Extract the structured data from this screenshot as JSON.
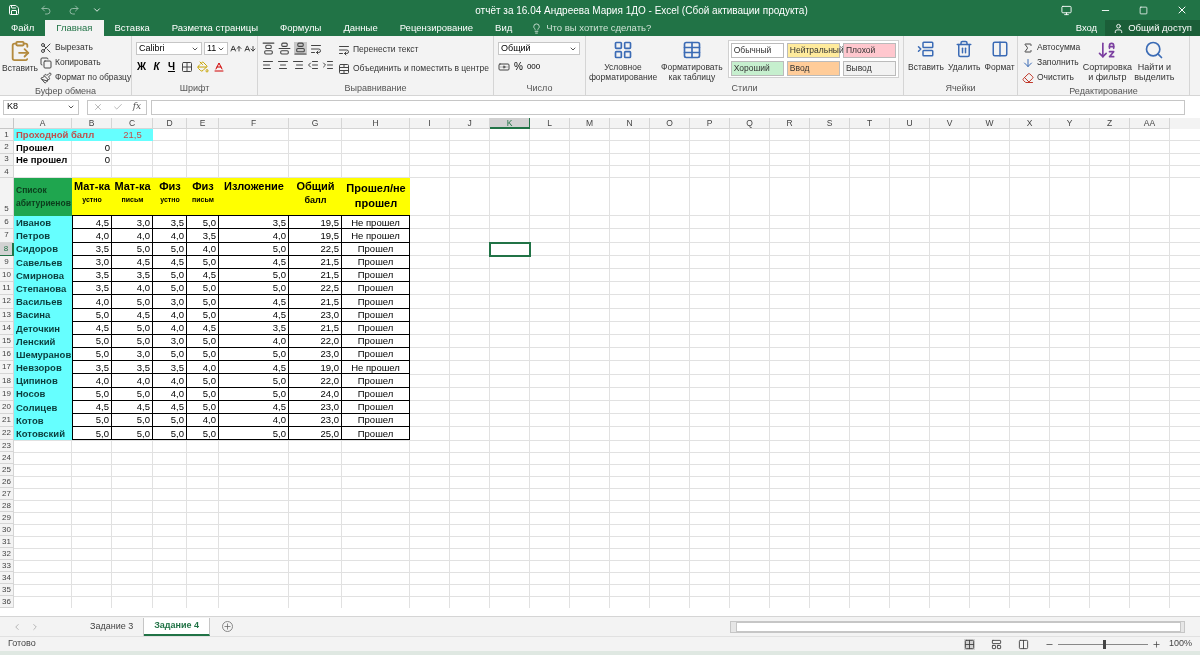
{
  "window": {
    "title": "отчёт за 16.04 Андреева Мария 1ДО - Excel (Сбой активации продукта)"
  },
  "menu_tabs": [
    {
      "label": "Файл",
      "selected": false
    },
    {
      "label": "Главная",
      "selected": true
    },
    {
      "label": "Вставка",
      "selected": false
    },
    {
      "label": "Разметка страницы",
      "selected": false
    },
    {
      "label": "Формулы",
      "selected": false
    },
    {
      "label": "Данные",
      "selected": false
    },
    {
      "label": "Рецензирование",
      "selected": false
    },
    {
      "label": "Вид",
      "selected": false
    }
  ],
  "tell_me": {
    "placeholder": "Что вы хотите сделать?"
  },
  "sign_in": "Вход",
  "share": "Общий доступ",
  "ribbon": {
    "clipboard": {
      "label": "Буфер обмена",
      "paste": "Вставить",
      "cut": "Вырезать",
      "copy": "Копировать",
      "format_painter": "Формат по образцу"
    },
    "font": {
      "label": "Шрифт",
      "font_name": "Calibri",
      "font_size": "11",
      "bold": "Ж",
      "italic": "К",
      "underline": "Ч"
    },
    "alignment": {
      "label": "Выравнивание",
      "wrap": "Перенести текст",
      "merge": "Объединить и поместить в центре",
      "valign": [
        {
          "selected": false
        },
        {
          "selected": false
        },
        {
          "selected": true
        }
      ]
    },
    "number": {
      "label": "Число",
      "format": "Общий",
      "percent": "%",
      "thousands": "000"
    },
    "styles": {
      "label": "Стили",
      "conditional": "Условное форматирование",
      "as_table": "Форматировать как таблицу",
      "presets": [
        {
          "name": "Обычный",
          "color": "#ffffff"
        },
        {
          "name": "Нейтральный",
          "color": "#ffeb9c"
        },
        {
          "name": "Плохой",
          "color": "#ffc7ce"
        },
        {
          "name": "Хороший",
          "color": "#c6efce"
        },
        {
          "name": "Ввод",
          "color": "#ffcc99"
        },
        {
          "name": "Вывод",
          "color": "#f2f2f2"
        }
      ]
    },
    "cells": {
      "label": "Ячейки",
      "buttons": [
        {
          "label": "Вставить",
          "kind": "insert"
        },
        {
          "label": "Удалить",
          "kind": "delete"
        },
        {
          "label": "Формат",
          "kind": "format"
        }
      ]
    },
    "editing": {
      "label": "Редактирование",
      "autosum": "Автосумма",
      "fill": "Заполнить",
      "clear": "Очистить",
      "sort": "Сортировка и фильтр",
      "find": "Найти и выделить"
    }
  },
  "formula_bar": {
    "name_box": "K8",
    "fx": "fx"
  },
  "sheet": {
    "columns": [
      {
        "label": "A",
        "selected": false
      },
      {
        "label": "B",
        "selected": false
      },
      {
        "label": "C",
        "selected": false
      },
      {
        "label": "D",
        "selected": false
      },
      {
        "label": "E",
        "selected": false
      },
      {
        "label": "F",
        "selected": false
      },
      {
        "label": "G",
        "selected": false
      },
      {
        "label": "H",
        "selected": false
      },
      {
        "label": "I",
        "selected": false
      },
      {
        "label": "J",
        "selected": false
      },
      {
        "label": "K",
        "selected": true
      },
      {
        "label": "L",
        "selected": false
      },
      {
        "label": "M",
        "selected": false
      },
      {
        "label": "N",
        "selected": false
      },
      {
        "label": "O",
        "selected": false
      },
      {
        "label": "P",
        "selected": false
      },
      {
        "label": "Q",
        "selected": false
      },
      {
        "label": "R",
        "selected": false
      },
      {
        "label": "S",
        "selected": false
      },
      {
        "label": "T",
        "selected": false
      },
      {
        "label": "U",
        "selected": false
      },
      {
        "label": "V",
        "selected": false
      },
      {
        "label": "W",
        "selected": false
      },
      {
        "label": "X",
        "selected": false
      },
      {
        "label": "Y",
        "selected": false
      },
      {
        "label": "Z",
        "selected": false
      },
      {
        "label": "AA",
        "selected": false
      }
    ],
    "rows": [
      {
        "number": "1",
        "selected": false,
        "kind": "passing",
        "label": "Проходной балл",
        "score": "21,5"
      },
      {
        "number": "2",
        "selected": false,
        "kind": "count",
        "label": "Прошел",
        "value": "0"
      },
      {
        "number": "3",
        "selected": false,
        "kind": "count",
        "label": "Не прошел",
        "value": "0"
      },
      {
        "number": "4",
        "selected": false,
        "kind": "blank"
      },
      {
        "number": "5",
        "selected": false,
        "kind": "header",
        "name_title": "Список абитуриенов",
        "subjects": [
          {
            "title": "Мат-ка",
            "sub": "устно"
          },
          {
            "title": "Мат-ка",
            "sub": "письм"
          },
          {
            "title": "Физ",
            "sub": "устно"
          },
          {
            "title": "Физ",
            "sub": "письм"
          }
        ],
        "essay": "Изложение",
        "total": "Общий",
        "total_sub": "балл",
        "result": "Прошел/не прошел"
      },
      {
        "number": "6",
        "selected": false,
        "kind": "student",
        "name": "Иванов",
        "scores": [
          "4,5",
          "3,0",
          "3,5",
          "5,0",
          "3,5"
        ],
        "total": "19,5",
        "result": "Не прошел"
      },
      {
        "number": "7",
        "selected": false,
        "kind": "student",
        "name": "Петров",
        "scores": [
          "4,0",
          "4,0",
          "4,0",
          "3,5",
          "4,0"
        ],
        "total": "19,5",
        "result": "Не прошел"
      },
      {
        "number": "8",
        "selected": true,
        "kind": "student",
        "name": "Сидоров",
        "scores": [
          "3,5",
          "5,0",
          "5,0",
          "4,0",
          "5,0"
        ],
        "total": "22,5",
        "result": "Прошел"
      },
      {
        "number": "9",
        "selected": false,
        "kind": "student",
        "name": "Савельев",
        "scores": [
          "3,0",
          "4,5",
          "4,5",
          "5,0",
          "4,5"
        ],
        "total": "21,5",
        "result": "Прошел"
      },
      {
        "number": "10",
        "selected": false,
        "kind": "student",
        "name": "Смирнова",
        "scores": [
          "3,5",
          "3,5",
          "5,0",
          "4,5",
          "5,0"
        ],
        "total": "21,5",
        "result": "Прошел"
      },
      {
        "number": "11",
        "selected": false,
        "kind": "student",
        "name": "Степанова",
        "scores": [
          "3,5",
          "4,0",
          "5,0",
          "5,0",
          "5,0"
        ],
        "total": "22,5",
        "result": "Прошел"
      },
      {
        "number": "12",
        "selected": false,
        "kind": "student",
        "name": "Васильев",
        "scores": [
          "4,0",
          "5,0",
          "3,0",
          "5,0",
          "4,5"
        ],
        "total": "21,5",
        "result": "Прошел"
      },
      {
        "number": "13",
        "selected": false,
        "kind": "student",
        "name": "Васина",
        "scores": [
          "5,0",
          "4,5",
          "4,0",
          "5,0",
          "4,5"
        ],
        "total": "23,0",
        "result": "Прошел"
      },
      {
        "number": "14",
        "selected": false,
        "kind": "student",
        "name": "Деточкин",
        "scores": [
          "4,5",
          "5,0",
          "4,0",
          "4,5",
          "3,5"
        ],
        "total": "21,5",
        "result": "Прошел"
      },
      {
        "number": "15",
        "selected": false,
        "kind": "student",
        "name": "Ленский",
        "scores": [
          "5,0",
          "5,0",
          "3,0",
          "5,0",
          "4,0"
        ],
        "total": "22,0",
        "result": "Прошел"
      },
      {
        "number": "16",
        "selected": false,
        "kind": "student",
        "name": "Шемуранов",
        "scores": [
          "5,0",
          "3,0",
          "5,0",
          "5,0",
          "5,0"
        ],
        "total": "23,0",
        "result": "Прошел"
      },
      {
        "number": "17",
        "selected": false,
        "kind": "student",
        "name": "Невзоров",
        "scores": [
          "3,5",
          "3,5",
          "3,5",
          "4,0",
          "4,5"
        ],
        "total": "19,0",
        "result": "Не прошел"
      },
      {
        "number": "18",
        "selected": false,
        "kind": "student",
        "name": "Ципинов",
        "scores": [
          "4,0",
          "4,0",
          "4,0",
          "5,0",
          "5,0"
        ],
        "total": "22,0",
        "result": "Прошел"
      },
      {
        "number": "19",
        "selected": false,
        "kind": "student",
        "name": "Носов",
        "scores": [
          "5,0",
          "5,0",
          "4,0",
          "5,0",
          "5,0"
        ],
        "total": "24,0",
        "result": "Прошел"
      },
      {
        "number": "20",
        "selected": false,
        "kind": "student",
        "name": "Солицев",
        "scores": [
          "4,5",
          "4,5",
          "4,5",
          "5,0",
          "4,5"
        ],
        "total": "23,0",
        "result": "Прошел"
      },
      {
        "number": "21",
        "selected": false,
        "kind": "student",
        "name": "Котов",
        "scores": [
          "5,0",
          "5,0",
          "5,0",
          "4,0",
          "4,0"
        ],
        "total": "23,0",
        "result": "Прошел"
      },
      {
        "number": "22",
        "selected": false,
        "kind": "student",
        "name": "Котовский",
        "scores": [
          "5,0",
          "5,0",
          "5,0",
          "5,0",
          "5,0"
        ],
        "total": "25,0",
        "result": "Прошел"
      },
      {
        "number": "23",
        "selected": false,
        "kind": "blank"
      },
      {
        "number": "24",
        "selected": false,
        "kind": "blank"
      },
      {
        "number": "25",
        "selected": false,
        "kind": "blank"
      },
      {
        "number": "26",
        "selected": false,
        "kind": "blank"
      },
      {
        "number": "27",
        "selected": false,
        "kind": "blank"
      },
      {
        "number": "28",
        "selected": false,
        "kind": "blank"
      },
      {
        "number": "29",
        "selected": false,
        "kind": "blank"
      },
      {
        "number": "30",
        "selected": false,
        "kind": "blank"
      },
      {
        "number": "31",
        "selected": false,
        "kind": "blank"
      },
      {
        "number": "32",
        "selected": false,
        "kind": "blank"
      },
      {
        "number": "33",
        "selected": false,
        "kind": "blank"
      },
      {
        "number": "34",
        "selected": false,
        "kind": "blank"
      },
      {
        "number": "35",
        "selected": false,
        "kind": "blank"
      },
      {
        "number": "36",
        "selected": false,
        "kind": "blank"
      }
    ]
  },
  "sheet_tabs": [
    {
      "label": "Задание 3",
      "selected": false
    },
    {
      "label": "Задание 4",
      "selected": true
    }
  ],
  "status_bar": {
    "status": "Готово",
    "zoom": {
      "level": 0.5,
      "reading": "100%"
    }
  }
}
